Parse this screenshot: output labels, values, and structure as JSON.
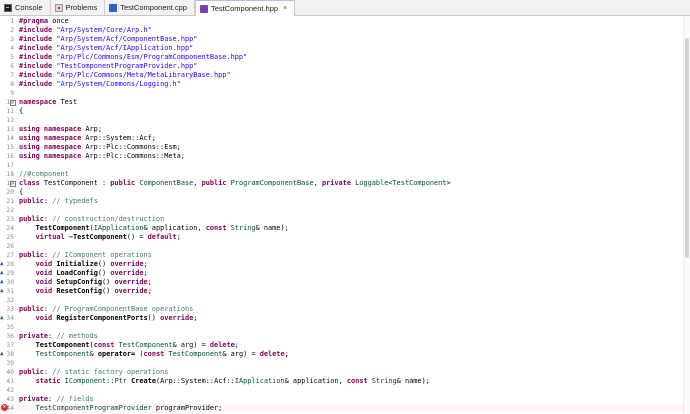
{
  "tabs": [
    {
      "label": "Console",
      "icon": "console-icon",
      "active": false
    },
    {
      "label": "Problems",
      "icon": "problems-icon",
      "active": false
    },
    {
      "label": "TestComponent.cpp",
      "icon": "cpp-file-icon",
      "active": false
    },
    {
      "label": "TestComponent.hpp",
      "icon": "hpp-file-icon",
      "active": true,
      "close": "×"
    }
  ],
  "editor": {
    "lines": [
      {
        "n": "1",
        "tokens": [
          [
            "pp",
            "#pragma"
          ],
          [
            "plain",
            " once"
          ]
        ]
      },
      {
        "n": "2",
        "tokens": [
          [
            "pp",
            "#include"
          ],
          [
            "plain",
            " "
          ],
          [
            "str",
            "\"Arp/System/Core/Arp.h\""
          ]
        ]
      },
      {
        "n": "3",
        "tokens": [
          [
            "pp",
            "#include"
          ],
          [
            "plain",
            " "
          ],
          [
            "str",
            "\"Arp/System/Acf/ComponentBase.hpp\""
          ]
        ]
      },
      {
        "n": "4",
        "tokens": [
          [
            "pp",
            "#include"
          ],
          [
            "plain",
            " "
          ],
          [
            "str",
            "\"Arp/System/Acf/IApplication.hpp\""
          ]
        ]
      },
      {
        "n": "5",
        "tokens": [
          [
            "pp",
            "#include"
          ],
          [
            "plain",
            " "
          ],
          [
            "str",
            "\"Arp/Plc/Commons/Esm/ProgramComponentBase.hpp\""
          ]
        ]
      },
      {
        "n": "6",
        "tokens": [
          [
            "pp",
            "#include"
          ],
          [
            "plain",
            " "
          ],
          [
            "str",
            "\"TestComponentProgramProvider.hpp\""
          ]
        ]
      },
      {
        "n": "7",
        "tokens": [
          [
            "pp",
            "#include"
          ],
          [
            "plain",
            " "
          ],
          [
            "str",
            "\"Arp/Plc/Commons/Meta/MetaLibraryBase.hpp\""
          ]
        ]
      },
      {
        "n": "8",
        "tokens": [
          [
            "pp",
            "#include"
          ],
          [
            "plain",
            " "
          ],
          [
            "str",
            "\"Arp/System/Commons/Logging.h\""
          ]
        ]
      },
      {
        "n": "9",
        "tokens": []
      },
      {
        "n": "10",
        "fold": "−",
        "tokens": [
          [
            "kw",
            "namespace"
          ],
          [
            "plain",
            " Test"
          ]
        ]
      },
      {
        "n": "11",
        "tokens": [
          [
            "plain",
            "{"
          ]
        ]
      },
      {
        "n": "12",
        "tokens": []
      },
      {
        "n": "13",
        "tokens": [
          [
            "kw",
            "using namespace"
          ],
          [
            "plain",
            " Arp;"
          ]
        ]
      },
      {
        "n": "14",
        "tokens": [
          [
            "kw",
            "using namespace"
          ],
          [
            "plain",
            " Arp::System::Acf;"
          ]
        ]
      },
      {
        "n": "15",
        "tokens": [
          [
            "kw",
            "using namespace"
          ],
          [
            "plain",
            " Arp::Plc::Commons::Esm;"
          ]
        ]
      },
      {
        "n": "16",
        "tokens": [
          [
            "kw",
            "using namespace"
          ],
          [
            "plain",
            " Arp::Plc::Commons::Meta;"
          ]
        ]
      },
      {
        "n": "17",
        "tokens": []
      },
      {
        "n": "18",
        "tokens": [
          [
            "cm",
            "//#component"
          ]
        ]
      },
      {
        "n": "19",
        "fold": "−",
        "tokens": [
          [
            "kw",
            "class"
          ],
          [
            "plain",
            " TestComponent : "
          ],
          [
            "kw",
            "public"
          ],
          [
            "plain",
            " "
          ],
          [
            "ty",
            "ComponentBase"
          ],
          [
            "plain",
            ", "
          ],
          [
            "kw",
            "public"
          ],
          [
            "plain",
            " "
          ],
          [
            "ty",
            "ProgramComponentBase"
          ],
          [
            "plain",
            ", "
          ],
          [
            "kw",
            "private"
          ],
          [
            "plain",
            " "
          ],
          [
            "ty",
            "Loggable"
          ],
          [
            "plain",
            "<"
          ],
          [
            "ty",
            "TestComponent"
          ],
          [
            "plain",
            ">"
          ]
        ]
      },
      {
        "n": "20",
        "tokens": [
          [
            "plain",
            "{"
          ]
        ]
      },
      {
        "n": "21",
        "tokens": [
          [
            "kw",
            "public"
          ],
          [
            "plain",
            ": "
          ],
          [
            "cm",
            "// typedefs"
          ]
        ]
      },
      {
        "n": "22",
        "tokens": []
      },
      {
        "n": "23",
        "tokens": [
          [
            "kw",
            "public"
          ],
          [
            "plain",
            ": "
          ],
          [
            "cm",
            "// construction/destruction"
          ]
        ]
      },
      {
        "n": "24",
        "tokens": [
          [
            "plain",
            "    "
          ],
          [
            "bold",
            "TestComponent"
          ],
          [
            "plain",
            "("
          ],
          [
            "ty",
            "IApplication"
          ],
          [
            "plain",
            "& application, "
          ],
          [
            "kw",
            "const"
          ],
          [
            "plain",
            " "
          ],
          [
            "ty",
            "String"
          ],
          [
            "plain",
            "& name);"
          ]
        ]
      },
      {
        "n": "25",
        "tokens": [
          [
            "plain",
            "    "
          ],
          [
            "kw",
            "virtual"
          ],
          [
            "plain",
            " "
          ],
          [
            "bold",
            "~TestComponent"
          ],
          [
            "plain",
            "() = "
          ],
          [
            "kw",
            "default"
          ],
          [
            "plain",
            ";"
          ]
        ]
      },
      {
        "n": "26",
        "tokens": []
      },
      {
        "n": "27",
        "tokens": [
          [
            "kw",
            "public"
          ],
          [
            "plain",
            ": "
          ],
          [
            "cm",
            "// IComponent operations"
          ]
        ]
      },
      {
        "n": "28",
        "marker": "▲",
        "tokens": [
          [
            "plain",
            "    "
          ],
          [
            "kw",
            "void"
          ],
          [
            "plain",
            " "
          ],
          [
            "bold",
            "Initialize"
          ],
          [
            "plain",
            "() "
          ],
          [
            "kw",
            "override"
          ],
          [
            "plain",
            ";"
          ]
        ]
      },
      {
        "n": "29",
        "marker": "▲",
        "tokens": [
          [
            "plain",
            "    "
          ],
          [
            "kw",
            "void"
          ],
          [
            "plain",
            " "
          ],
          [
            "bold",
            "LoadConfig"
          ],
          [
            "plain",
            "() "
          ],
          [
            "kw",
            "override"
          ],
          [
            "plain",
            ";"
          ]
        ]
      },
      {
        "n": "30",
        "marker": "▲",
        "tokens": [
          [
            "plain",
            "    "
          ],
          [
            "kw",
            "void"
          ],
          [
            "plain",
            " "
          ],
          [
            "bold",
            "SetupConfig"
          ],
          [
            "plain",
            "() "
          ],
          [
            "kw",
            "override"
          ],
          [
            "plain",
            ";"
          ]
        ]
      },
      {
        "n": "31",
        "marker": "▲",
        "tokens": [
          [
            "plain",
            "    "
          ],
          [
            "kw",
            "void"
          ],
          [
            "plain",
            " "
          ],
          [
            "bold",
            "ResetConfig"
          ],
          [
            "plain",
            "() "
          ],
          [
            "kw",
            "override"
          ],
          [
            "plain",
            ";"
          ]
        ]
      },
      {
        "n": "32",
        "tokens": []
      },
      {
        "n": "33",
        "tokens": [
          [
            "kw",
            "public"
          ],
          [
            "plain",
            ": "
          ],
          [
            "cm",
            "// ProgramComponentBase operations"
          ]
        ]
      },
      {
        "n": "34",
        "marker": "▲",
        "tokens": [
          [
            "plain",
            "    "
          ],
          [
            "kw",
            "void"
          ],
          [
            "plain",
            " "
          ],
          [
            "bold",
            "RegisterComponentPorts"
          ],
          [
            "plain",
            "() "
          ],
          [
            "kw",
            "override"
          ],
          [
            "plain",
            ";"
          ]
        ]
      },
      {
        "n": "35",
        "tokens": []
      },
      {
        "n": "36",
        "tokens": [
          [
            "kw",
            "private"
          ],
          [
            "plain",
            ": "
          ],
          [
            "cm",
            "// methods"
          ]
        ]
      },
      {
        "n": "37",
        "tokens": [
          [
            "plain",
            "    "
          ],
          [
            "bold",
            "TestComponent"
          ],
          [
            "plain",
            "("
          ],
          [
            "kw",
            "const"
          ],
          [
            "plain",
            " "
          ],
          [
            "ty",
            "TestComponent"
          ],
          [
            "plain",
            "& arg) = "
          ],
          [
            "kw",
            "delete"
          ],
          [
            "plain",
            ";"
          ]
        ]
      },
      {
        "n": "38",
        "marker": "▲",
        "tokens": [
          [
            "plain",
            "    "
          ],
          [
            "ty",
            "TestComponent"
          ],
          [
            "plain",
            "& "
          ],
          [
            "bold",
            "operator="
          ],
          [
            "plain",
            " ("
          ],
          [
            "kw",
            "const"
          ],
          [
            "plain",
            " "
          ],
          [
            "ty",
            "TestComponent"
          ],
          [
            "plain",
            "& arg) = "
          ],
          [
            "kw",
            "delete"
          ],
          [
            "plain",
            ";"
          ]
        ]
      },
      {
        "n": "39",
        "tokens": []
      },
      {
        "n": "40",
        "tokens": [
          [
            "kw",
            "public"
          ],
          [
            "plain",
            ": "
          ],
          [
            "cm",
            "// static factory operations"
          ]
        ]
      },
      {
        "n": "41",
        "tokens": [
          [
            "plain",
            "    "
          ],
          [
            "kw",
            "static"
          ],
          [
            "plain",
            " "
          ],
          [
            "ty",
            "IComponent"
          ],
          [
            "plain",
            "::"
          ],
          [
            "ty",
            "Ptr"
          ],
          [
            "plain",
            " "
          ],
          [
            "bold",
            "Create"
          ],
          [
            "plain",
            "(Arp::System::Acf::"
          ],
          [
            "ty",
            "IApplication"
          ],
          [
            "plain",
            "& application, "
          ],
          [
            "kw",
            "const"
          ],
          [
            "plain",
            " "
          ],
          [
            "ty",
            "String"
          ],
          [
            "plain",
            "& name);"
          ]
        ]
      },
      {
        "n": "42",
        "tokens": []
      },
      {
        "n": "43",
        "tokens": [
          [
            "kw",
            "private"
          ],
          [
            "plain",
            ": "
          ],
          [
            "cm",
            "// fields"
          ]
        ]
      },
      {
        "n": "44",
        "error": true,
        "tokens": [
          [
            "plain",
            "    "
          ],
          [
            "ty",
            "TestComponentProgramProvider"
          ],
          [
            "plain",
            " programProvider;"
          ]
        ]
      }
    ]
  }
}
